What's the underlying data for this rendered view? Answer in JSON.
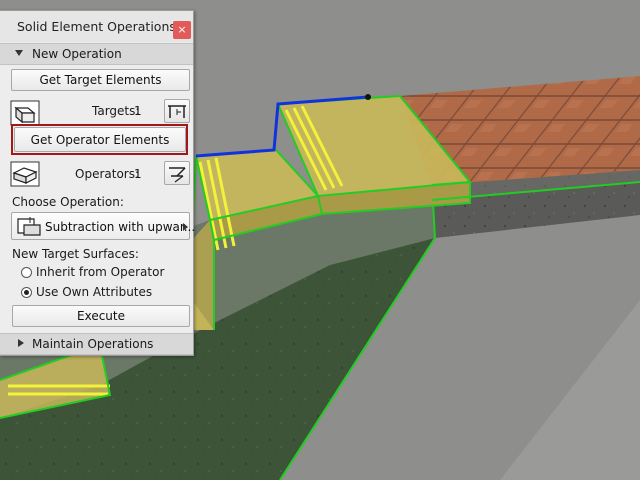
{
  "palette": {
    "title": "Solid Element Operations",
    "close_glyph": "×",
    "new_operation_header": "New Operation",
    "get_target_label": "Get Target Elements",
    "targets_label": "Targets:",
    "targets_count": "1",
    "get_operator_label": "Get Operator Elements",
    "operators_label": "Operators:",
    "operators_count": "1",
    "choose_operation_label": "Choose Operation:",
    "operation_value": "Subtraction with upwar...",
    "new_target_surfaces_label": "New Target Surfaces:",
    "radio_options": [
      {
        "label": "Inherit from Operator",
        "selected": false
      },
      {
        "label": "Use Own Attributes",
        "selected": true
      }
    ],
    "execute_label": "Execute",
    "maintain_operations_header": "Maintain Operations"
  },
  "colors": {
    "highlight_border": "#a01818",
    "close_button": "#e35a5a",
    "selection_green": "#22cc22",
    "edge_blue": "#1133dd",
    "stair_fill": "#c8b75a"
  }
}
